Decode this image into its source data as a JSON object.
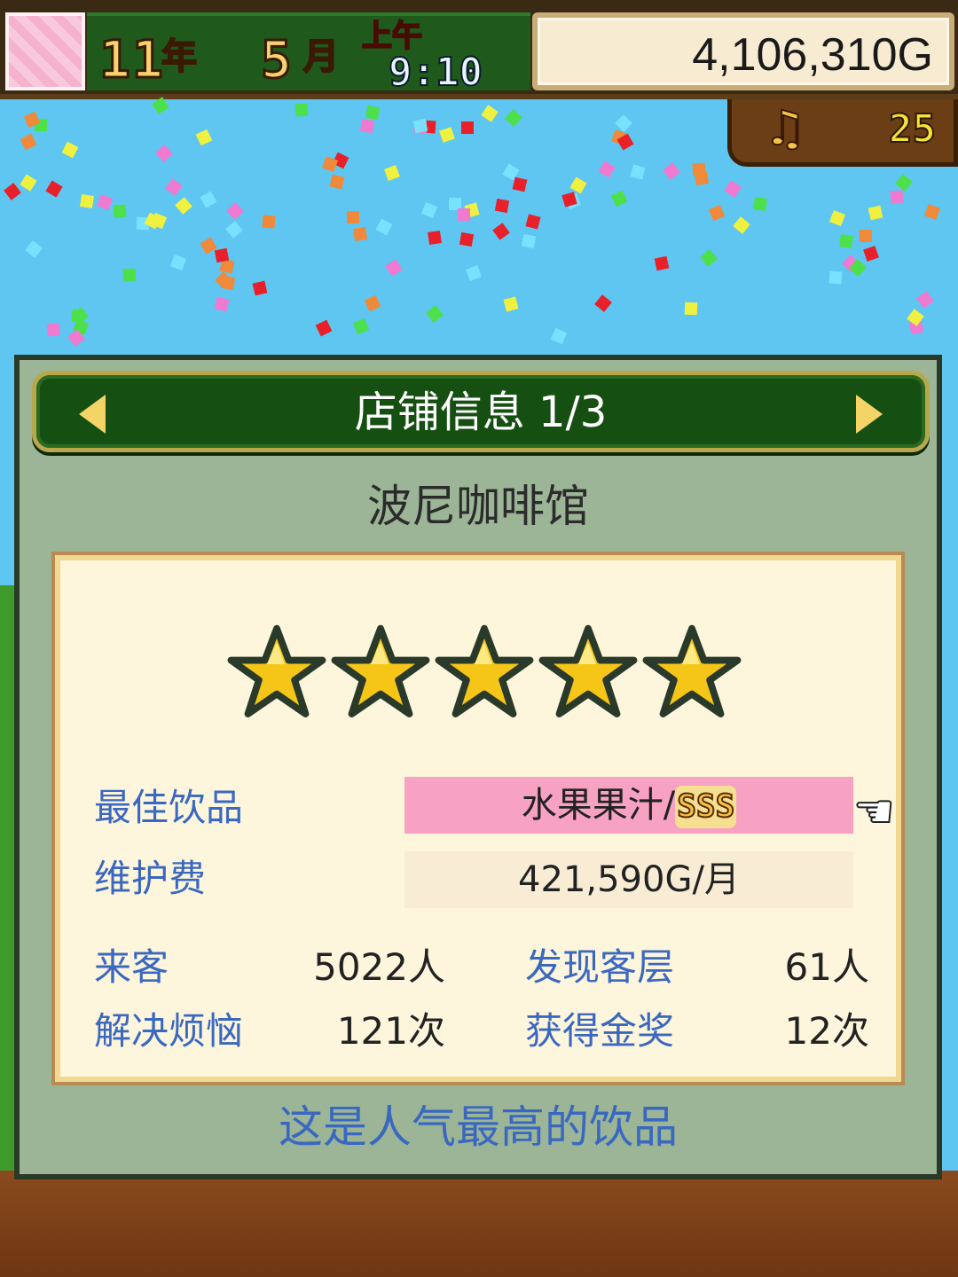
{
  "hud": {
    "year_num": "11",
    "year_unit": "年",
    "month_num": "5",
    "month_unit": "月",
    "ampm": "上午",
    "time": "9:10",
    "money": "4,106,310G",
    "music_icon": "music-note-icon",
    "music_count": "25"
  },
  "dialog": {
    "title": "店铺信息 1/3",
    "shop_name": "波尼咖啡馆",
    "rating_stars": 5,
    "best_drink": {
      "label": "最佳饮品",
      "value": "水果果汁/",
      "grade": "SSS"
    },
    "maintenance": {
      "label": "维护费",
      "value": "421,590G/月"
    },
    "stats": {
      "visitors_label": "来客",
      "visitors_value": "5022人",
      "found_label": "发现客层",
      "found_value": "61人",
      "solved_label": "解决烦恼",
      "solved_value": "121次",
      "gold_label": "获得金奖",
      "gold_value": "12次"
    },
    "hint": "这是人气最高的饮品"
  },
  "colors": {
    "label_blue": "#3a68c0",
    "title_green": "#164f12",
    "highlight_pink": "#f7a2c2",
    "star_gold": "#f5c518"
  }
}
